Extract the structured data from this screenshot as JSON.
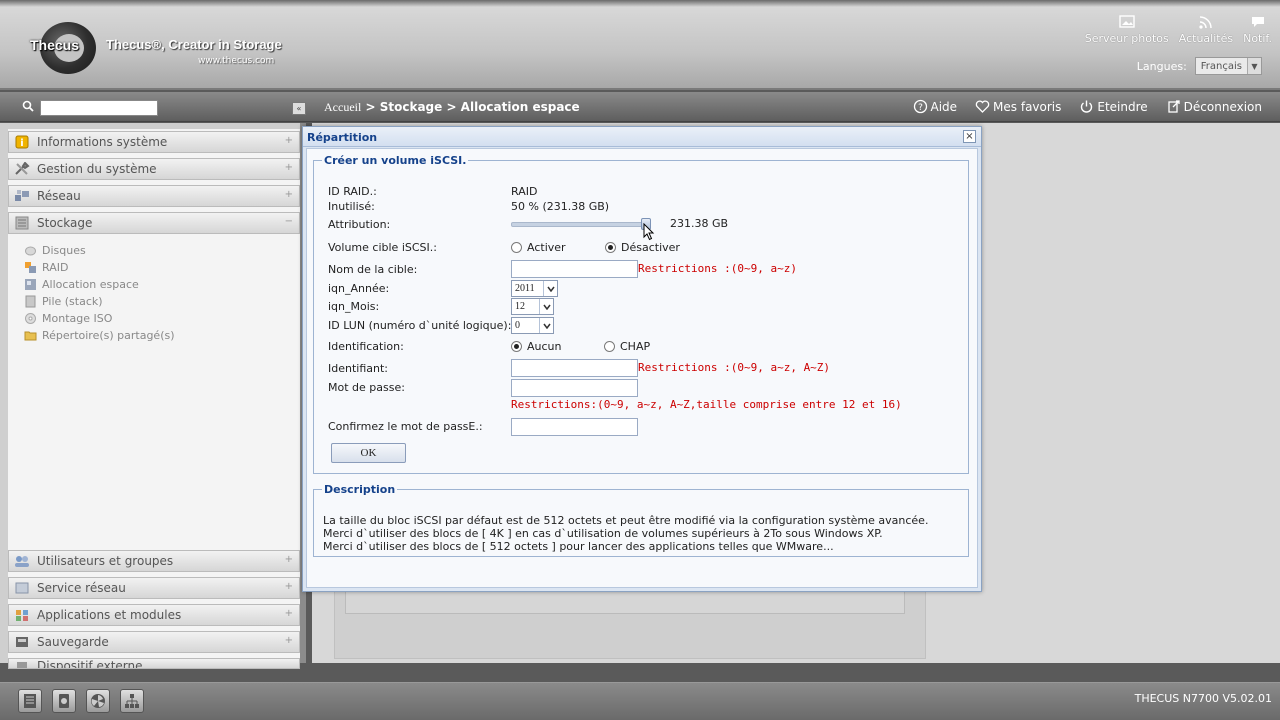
{
  "header": {
    "logo_text": "Thecus",
    "tagline": "Thecus®, Creator in Storage",
    "website": "www.thecus.com",
    "tools": [
      {
        "label": "Serveur photos",
        "icon": "photo-icon"
      },
      {
        "label": "Actualités",
        "icon": "rss-icon"
      },
      {
        "label": "Notif.",
        "icon": "chat-icon"
      }
    ],
    "language_label": "Langues:",
    "language_value": "Français"
  },
  "navbar": {
    "breadcrumb_first": "Accueil",
    "breadcrumb_rest": " > Stockage > Allocation espace",
    "tools": [
      {
        "label": "Aide",
        "icon": "help-icon"
      },
      {
        "label": "Mes favoris",
        "icon": "heart-icon"
      },
      {
        "label": "Eteindre",
        "icon": "power-icon"
      },
      {
        "label": "Déconnexion",
        "icon": "logout-icon"
      }
    ]
  },
  "sidebar": {
    "menu_top": [
      {
        "label": "Informations système",
        "icon": "info-icon"
      },
      {
        "label": "Gestion du système",
        "icon": "tools-icon"
      },
      {
        "label": "Réseau",
        "icon": "network-icon"
      },
      {
        "label": "Stockage",
        "icon": "storage-icon"
      }
    ],
    "sub_items": [
      {
        "label": "Disques",
        "icon": "disk-icon"
      },
      {
        "label": "RAID",
        "icon": "raid-icon"
      },
      {
        "label": "Allocation espace",
        "icon": "allocation-icon"
      },
      {
        "label": "Pile (stack)",
        "icon": "stack-icon"
      },
      {
        "label": "Montage ISO",
        "icon": "iso-icon"
      },
      {
        "label": "Répertoire(s) partagé(s)",
        "icon": "folder-icon"
      }
    ],
    "menu_bottom": [
      {
        "label": "Utilisateurs et groupes",
        "icon": "users-icon"
      },
      {
        "label": "Service réseau",
        "icon": "service-icon"
      },
      {
        "label": "Applications et modules",
        "icon": "apps-icon"
      },
      {
        "label": "Sauvegarde",
        "icon": "backup-icon"
      },
      {
        "label": "Dispositif externe",
        "icon": "device-icon"
      }
    ]
  },
  "dialog": {
    "title": "Répartition",
    "close": "×",
    "form_legend": "Créer un volume iSCSI.",
    "raid_id_label": "ID RAID.:",
    "raid_id_value": "RAID",
    "unused_label": "Inutilisé:",
    "unused_value": "50 % (231.38 GB)",
    "allocation_label": "Attribution:",
    "allocation_value": "231.38 GB",
    "allocation_fraction": 1.0,
    "target_volume_label": "Volume cible iSCSI.:",
    "target_enable": "Activer",
    "target_disable": "Désactiver",
    "target_name_label": "Nom de la cible:",
    "target_name_value": "",
    "target_name_restriction": "Restrictions :(0~9, a~z)",
    "iqn_year_label": "iqn_Année:",
    "iqn_year_value": "2011",
    "iqn_month_label": "iqn_Mois:",
    "iqn_month_value": "12",
    "lun_label": "ID LUN (numéro d`unité logique):",
    "lun_value": "0",
    "auth_label": "Identification:",
    "auth_none": "Aucun",
    "auth_chap": "CHAP",
    "username_label": "Identifiant:",
    "username_value": "",
    "username_restriction": "Restrictions :(0~9, a~z, A~Z)",
    "password_label": "Mot de passe:",
    "password_value": "",
    "password_restriction": "Restrictions:(0~9, a~z, A~Z,taille comprise entre 12 et 16)",
    "confirm_label": "Confirmez le mot de passE.:",
    "confirm_value": "",
    "ok_label": "OK",
    "desc_legend": "Description",
    "desc_line1": "La taille du bloc iSCSI par défaut est de 512 octets et peut être modifié via la configuration système avancée.",
    "desc_line2": "Merci d`utiliser des blocs de [ 4K ] en cas d`utilisation de volumes supérieurs à 2To sous Windows XP.",
    "desc_line3": "Merci d`utiliser des blocs de [ 512 octets ] pour lancer des applications telles que WMware..."
  },
  "footer": {
    "icons": [
      "server-icon",
      "disk-icon",
      "fan-icon",
      "network-tree-icon"
    ],
    "version": "THECUS N7700 V5.02.01"
  }
}
